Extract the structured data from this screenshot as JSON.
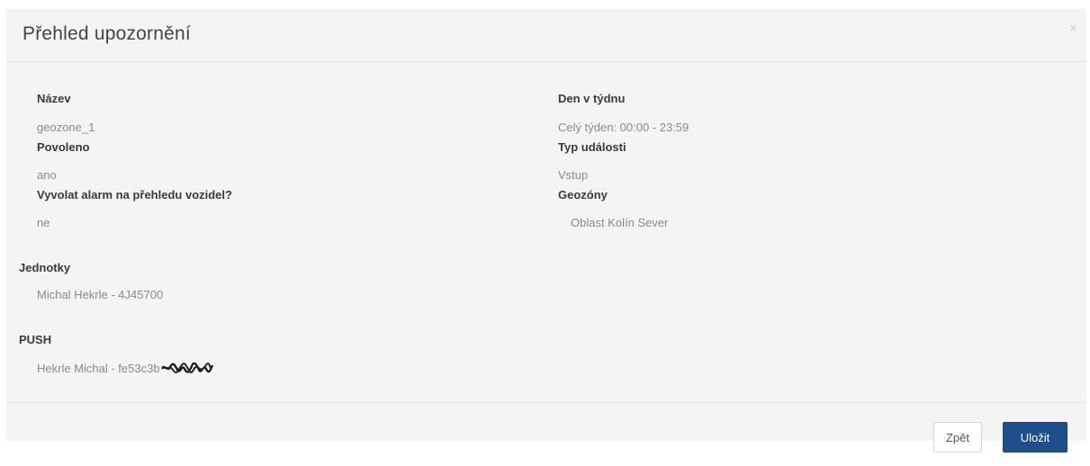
{
  "modal": {
    "title": "Přehled upozornění",
    "close_label": "×"
  },
  "left_fields": [
    {
      "label": "Název",
      "value": "geozone_1"
    },
    {
      "label": "Povoleno",
      "value": "ano"
    },
    {
      "label": "Vyvolat alarm na přehledu vozidel?",
      "value": "ne"
    }
  ],
  "right_fields": [
    {
      "label": "Den v týdnu",
      "value": "Celý týden: 00:00 - 23:59"
    },
    {
      "label": "Typ události",
      "value": "Vstup"
    },
    {
      "label": "Geozóny",
      "value": "Oblast Kolín Sever"
    }
  ],
  "units": {
    "label": "Jednotky",
    "value": "Michal Hekrle - 4J45700"
  },
  "push": {
    "label": "PUSH",
    "value": "Hekrle Michal - fe53c3b"
  },
  "footer": {
    "back_label": "Zpět",
    "save_label": "Uložit"
  }
}
